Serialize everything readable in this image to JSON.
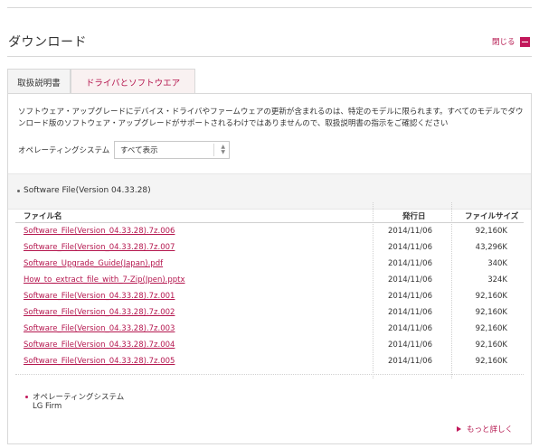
{
  "page": {
    "title": "ダウンロード",
    "close_label": "閉じる"
  },
  "tabs": [
    {
      "label": "取扱説明書",
      "active": false
    },
    {
      "label": "ドライバとソフトウエア",
      "active": true
    }
  ],
  "description": "ソフトウェア・アップグレードにデバイス・ドライバやファームウェアの更新が含まれるのは、特定のモデルに限られます。すべてのモデルでダウンロード版のソフトウェア・アップグレードがサポートされるわけではありませんので、取扱説明書の指示をご確認ください",
  "os_filter": {
    "label": "オペレーティングシステム",
    "selected": "すべて表示"
  },
  "section": {
    "title": "Software File(Version 04.33.28)"
  },
  "table": {
    "headers": {
      "name": "ファイル名",
      "date": "発行日",
      "size": "ファイルサイズ"
    },
    "rows": [
      {
        "name": "Software_File(Version_04.33.28).7z.006",
        "date": "2014/11/06",
        "size": "92,160K"
      },
      {
        "name": "Software_File(Version_04.33.28).7z.007",
        "date": "2014/11/06",
        "size": "43,296K"
      },
      {
        "name": "Software_Upgrade_Guide(Japan).pdf",
        "date": "2014/11/06",
        "size": "340K"
      },
      {
        "name": "How_to_extract_file_with_7-Zip(Jpen).pptx",
        "date": "2014/11/06",
        "size": "324K"
      },
      {
        "name": "Software_File(Version_04.33.28).7z.001",
        "date": "2014/11/06",
        "size": "92,160K"
      },
      {
        "name": "Software_File(Version_04.33.28).7z.002",
        "date": "2014/11/06",
        "size": "92,160K"
      },
      {
        "name": "Software_File(Version_04.33.28).7z.003",
        "date": "2014/11/06",
        "size": "92,160K"
      },
      {
        "name": "Software_File(Version_04.33.28).7z.004",
        "date": "2014/11/06",
        "size": "92,160K"
      },
      {
        "name": "Software_File(Version_04.33.28).7z.005",
        "date": "2014/11/06",
        "size": "92,160K"
      }
    ]
  },
  "os_info": {
    "label": "オペレーティングシステム",
    "value": "LG Firm"
  },
  "more_label": "もっと詳しく",
  "colors": {
    "accent": "#c2185b",
    "link": "#b5174f",
    "border": "#d8d8d8",
    "band": "#f4f4f4"
  }
}
